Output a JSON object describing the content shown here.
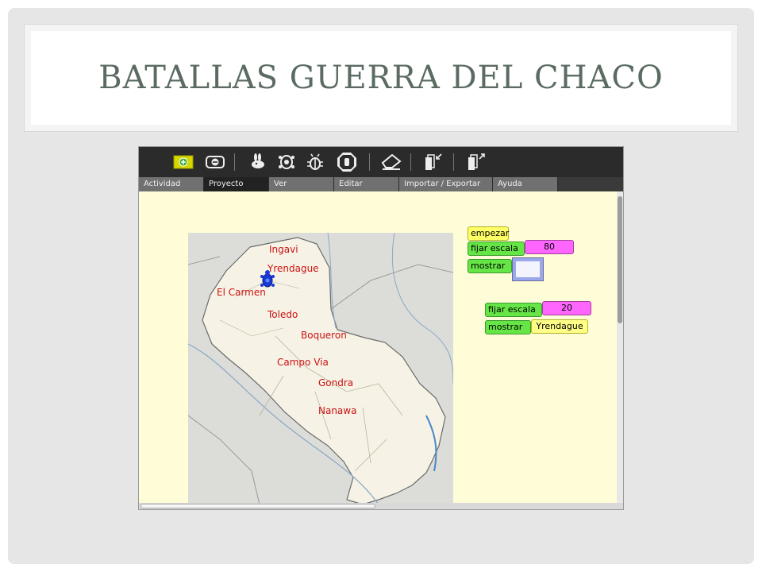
{
  "slide": {
    "title": "BATALLAS GUERRA DEL CHACO"
  },
  "app": {
    "toolbar": {
      "icons": [
        "new-block-icon",
        "delete-block-icon",
        "rabbit-run-icon",
        "turtle-step-icon",
        "bug-debug-icon",
        "stop-hand-icon",
        "eraser-icon",
        "collapse-icon",
        "expand-icon"
      ]
    },
    "menu": {
      "tabs": [
        "Actividad",
        "Proyecto",
        "Ver",
        "Editar",
        "Importar / Exportar",
        "Ayuda"
      ],
      "active": "Proyecto"
    },
    "map": {
      "labels": [
        "Ingavi",
        "Yrendague",
        "El Carmen",
        "Toledo",
        "Boqueron",
        "Campo Via",
        "Gondra",
        "Nanawa"
      ]
    },
    "blocks": {
      "stack1": {
        "start": "empezar",
        "set_scale": "fijar escala",
        "scale_value": "80",
        "show": "mostrar"
      },
      "stack2": {
        "set_scale": "fijar escala",
        "scale_value": "20",
        "show": "mostrar",
        "show_value": "Yrendague"
      }
    },
    "colors": {
      "toolbar": "#2b2b2b",
      "canvas": "#fffdd8",
      "label": "#cc1111",
      "block_green": "#66e646",
      "block_yellow": "#ffff66",
      "block_magenta": "#ff66ff"
    }
  }
}
